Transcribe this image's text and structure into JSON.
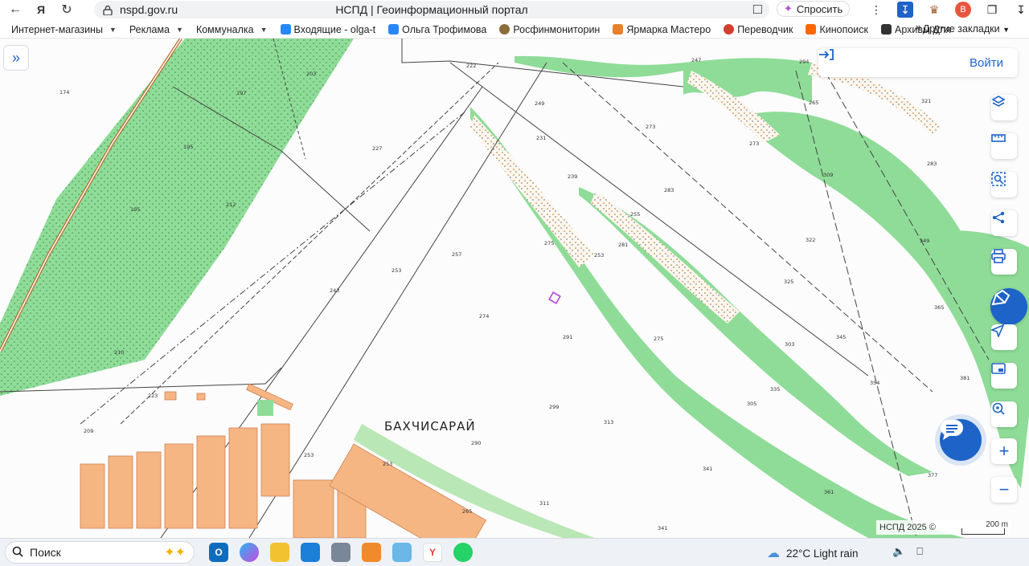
{
  "browser": {
    "url": "nspd.gov.ru",
    "title": "НСПД | Геоинформационный портал",
    "ask_label": "Спросить"
  },
  "bookmarks": {
    "items": [
      {
        "label": "Интернет-магазины",
        "caret": true,
        "color": ""
      },
      {
        "label": "Реклама",
        "caret": true,
        "color": ""
      },
      {
        "label": "Коммуналка",
        "caret": true,
        "color": ""
      },
      {
        "label": "Входящие - olga-t",
        "caret": false,
        "color": "#2787f5"
      },
      {
        "label": "Ольга Трофимова",
        "caret": false,
        "color": "#2787f5"
      },
      {
        "label": "Росфинмониторин",
        "caret": false,
        "color": "#8a6d3b"
      },
      {
        "label": "Ярмарка Мастеро",
        "caret": false,
        "color": "#e8812b"
      },
      {
        "label": "Переводчик",
        "caret": false,
        "color": "#d43f2f"
      },
      {
        "label": "Кинопоиск",
        "caret": false,
        "color": "#ff6600"
      },
      {
        "label": "Архивы Для",
        "caret": false,
        "color": "#333333"
      }
    ],
    "more": "»",
    "other": "Другие закладки"
  },
  "map": {
    "login_label": "Войти",
    "place_name": "БАХЧИСАРАЙ",
    "attribution": "НСПД 2025 ©",
    "scale_label": "200 m",
    "elevations": [
      {
        "t": "203"
      },
      {
        "t": "197"
      },
      {
        "t": "174"
      },
      {
        "t": "195"
      },
      {
        "t": "212"
      },
      {
        "t": "195"
      },
      {
        "t": "210"
      },
      {
        "t": "222"
      },
      {
        "t": "227"
      },
      {
        "t": "249"
      },
      {
        "t": "231"
      },
      {
        "t": "239"
      },
      {
        "t": "247"
      },
      {
        "t": "294"
      },
      {
        "t": "265"
      },
      {
        "t": "321"
      },
      {
        "t": "273"
      },
      {
        "t": "273"
      },
      {
        "t": "283"
      },
      {
        "t": "309"
      },
      {
        "t": "283"
      },
      {
        "t": "255"
      },
      {
        "t": "275"
      },
      {
        "t": "281"
      },
      {
        "t": "253"
      },
      {
        "t": "257"
      },
      {
        "t": "253"
      },
      {
        "t": "243"
      },
      {
        "t": "274"
      },
      {
        "t": "291"
      },
      {
        "t": "322"
      },
      {
        "t": "349"
      },
      {
        "t": "325"
      },
      {
        "t": "365"
      },
      {
        "t": "275"
      },
      {
        "t": "303"
      },
      {
        "t": "345"
      },
      {
        "t": "335"
      },
      {
        "t": "354"
      },
      {
        "t": "305"
      },
      {
        "t": "381"
      },
      {
        "t": "299"
      },
      {
        "t": "313"
      },
      {
        "t": "290"
      },
      {
        "t": "223"
      },
      {
        "t": "209"
      },
      {
        "t": "253"
      },
      {
        "t": "253"
      },
      {
        "t": "265"
      },
      {
        "t": "341"
      },
      {
        "t": "311"
      },
      {
        "t": "361"
      },
      {
        "t": "377"
      },
      {
        "t": "341"
      }
    ]
  },
  "taskbar": {
    "search_label": "Поиск",
    "weather": "22°C  Light rain"
  }
}
